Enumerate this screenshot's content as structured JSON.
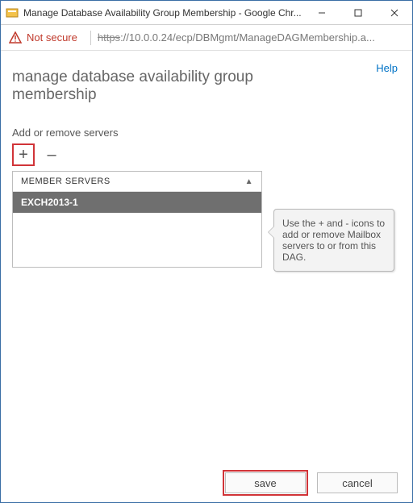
{
  "window": {
    "title": "Manage Database Availability Group Membership - Google Chr..."
  },
  "addressbar": {
    "not_secure": "Not secure",
    "protocol": "https",
    "url_rest": "://10.0.0.24/ecp/DBMgmt/ManageDAGMembership.a..."
  },
  "links": {
    "help": "Help"
  },
  "page": {
    "title": "manage database availability group membership",
    "section_label": "Add or remove servers"
  },
  "toolbar": {
    "add": "+",
    "remove": "–"
  },
  "list": {
    "header": "MEMBER SERVERS",
    "sort_glyph": "▲",
    "rows": [
      "EXCH2013-1"
    ]
  },
  "callout": {
    "text": "Use the + and - icons to add or remove Mailbox servers to or from this DAG."
  },
  "buttons": {
    "save": "save",
    "cancel": "cancel"
  }
}
